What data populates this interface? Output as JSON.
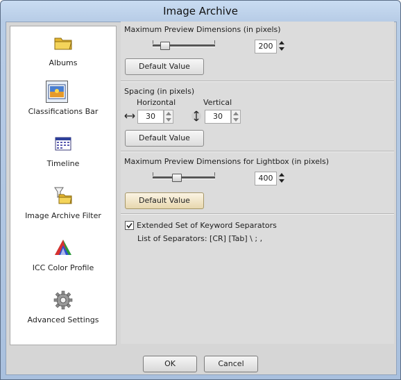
{
  "window": {
    "title": "Image Archive"
  },
  "sidebar": {
    "items": [
      {
        "label": "Albums",
        "icon": "folder-icon"
      },
      {
        "label": "Classifications Bar",
        "icon": "picture-icon"
      },
      {
        "label": "Timeline",
        "icon": "calendar-icon"
      },
      {
        "label": "Image Archive Filter",
        "icon": "filter-folder-icon"
      },
      {
        "label": "ICC Color Profile",
        "icon": "color-triangle-icon"
      },
      {
        "label": "Advanced Settings",
        "icon": "gear-icon"
      }
    ],
    "selected_index": 1
  },
  "preview": {
    "title": "Maximum Preview Dimensions (in pixels)",
    "value": "200",
    "default_button": "Default Value"
  },
  "spacing": {
    "title": "Spacing (in pixels)",
    "horizontal_label": "Horizontal",
    "vertical_label": "Vertical",
    "horizontal_value": "30",
    "vertical_value": "30",
    "default_button": "Default Value"
  },
  "lightbox": {
    "title": "Maximum Preview Dimensions for Lightbox (in pixels)",
    "value": "400",
    "default_button": "Default Value"
  },
  "keywords": {
    "checkbox_label": "Extended Set of Keyword Separators",
    "checked": true,
    "separators_text": "List of Separators: [CR] [Tab] \\ ; ,"
  },
  "footer": {
    "ok_label": "OK",
    "cancel_label": "Cancel"
  }
}
